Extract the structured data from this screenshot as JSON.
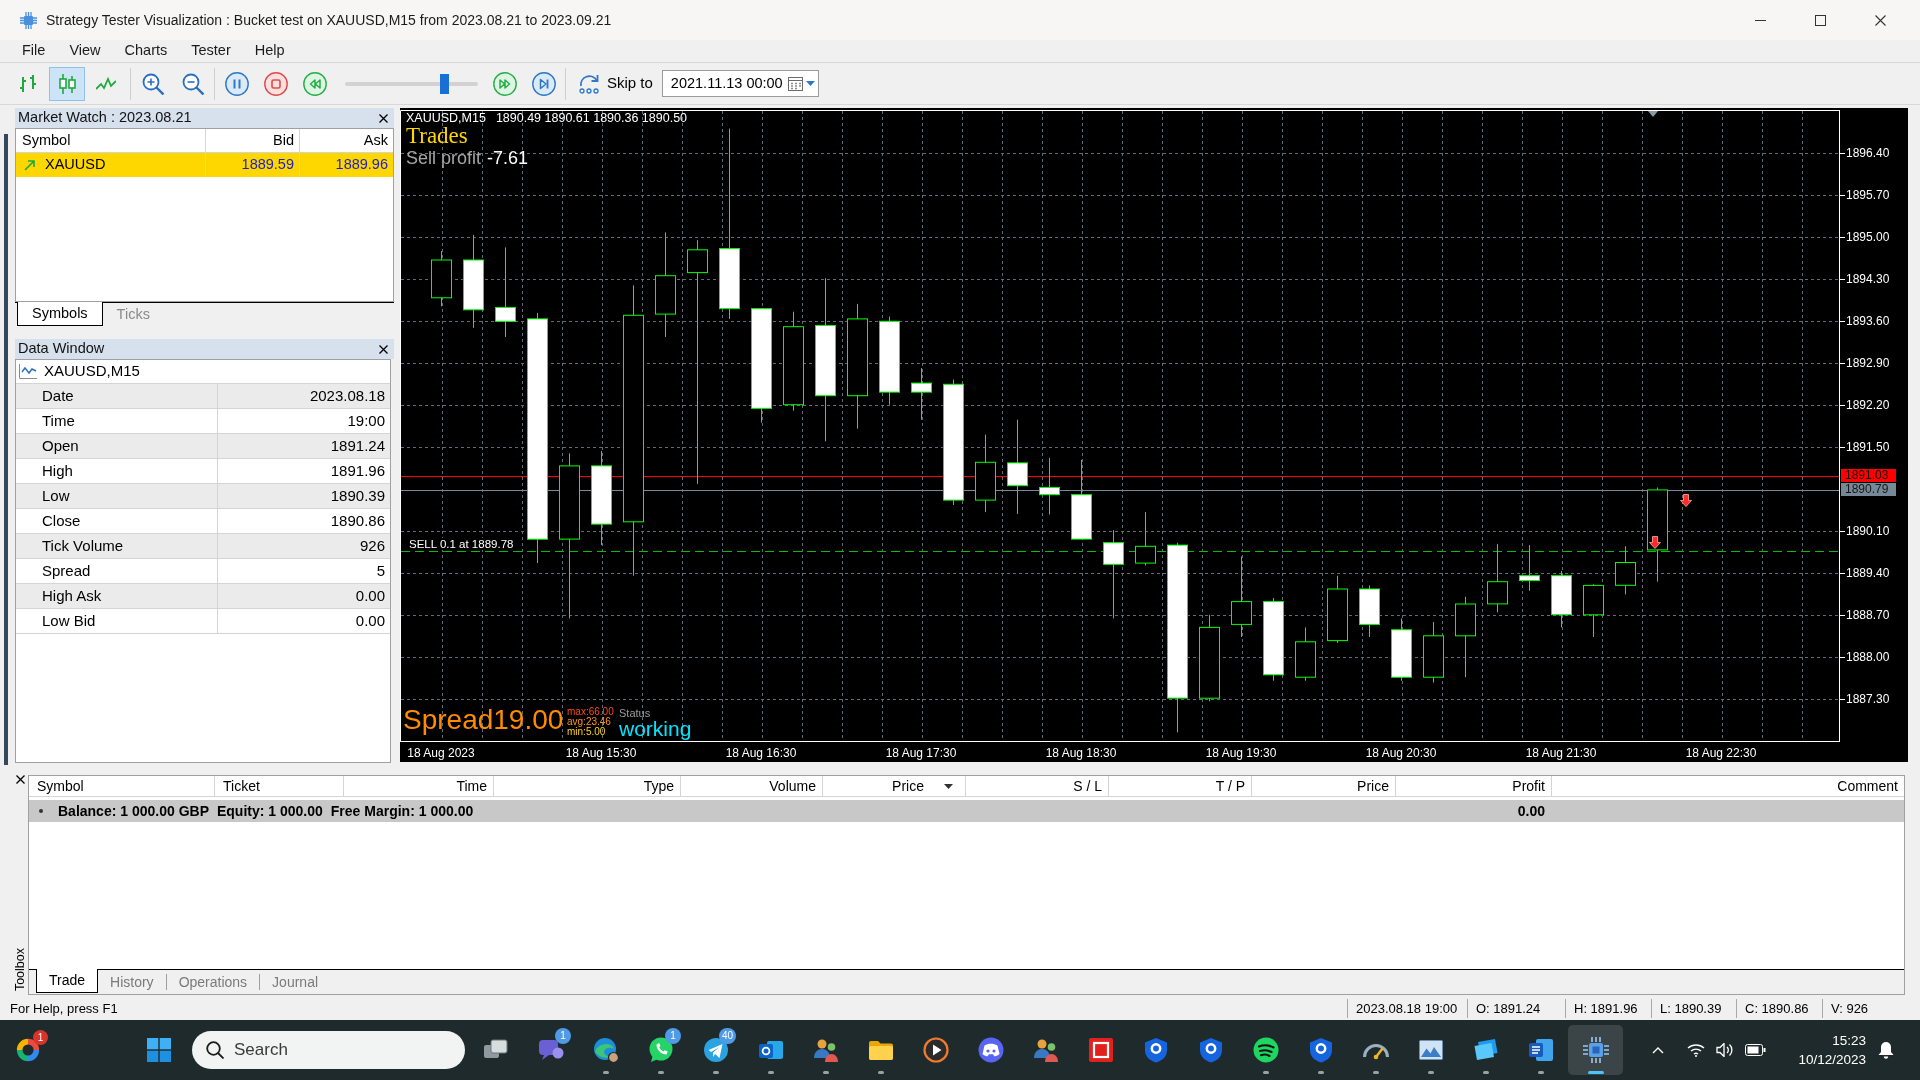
{
  "window": {
    "title": "Strategy Tester Visualization : Bucket test on XAUUSD,M15 from 2023.08.21 to 2023.09.21"
  },
  "menu": [
    "File",
    "View",
    "Charts",
    "Tester",
    "Help"
  ],
  "toolbar": {
    "chart_types": [
      {
        "kind": "bars",
        "selected": false
      },
      {
        "kind": "candles",
        "selected": true
      },
      {
        "kind": "line",
        "selected": false
      }
    ],
    "speed_slider": {
      "level": 0.75
    },
    "skip_label": "Skip to",
    "skip_date": "2021.11.13 00:00"
  },
  "market_watch": {
    "title": "Market Watch : 2023.08.21",
    "columns": [
      "Symbol",
      "Bid",
      "Ask"
    ],
    "rows": [
      {
        "symbol": "XAUUSD",
        "bid": "1889.59",
        "ask": "1889.96",
        "selected": true
      }
    ],
    "tabs": [
      {
        "label": "Symbols",
        "selected": true
      },
      {
        "label": "Ticks",
        "selected": false
      }
    ]
  },
  "data_window": {
    "title": "Data Window",
    "symbol": "XAUUSD,M15",
    "rows": [
      {
        "label": "Date",
        "value": "2023.08.18"
      },
      {
        "label": "Time",
        "value": "19:00"
      },
      {
        "label": "Open",
        "value": "1891.24"
      },
      {
        "label": "High",
        "value": "1891.96"
      },
      {
        "label": "Low",
        "value": "1890.39"
      },
      {
        "label": "Close",
        "value": "1890.86"
      },
      {
        "label": "Tick Volume",
        "value": "926"
      },
      {
        "label": "Spread",
        "value": "5"
      },
      {
        "label": "High Ask",
        "value": "0.00"
      },
      {
        "label": "Low Bid",
        "value": "0.00"
      }
    ]
  },
  "chart": {
    "symbol": "XAUUSD,M15",
    "quote": "1890.49 1890.61 1890.36 1890.50",
    "title": "Trades",
    "profit_label": "Sell profit",
    "profit_value": "-7.61",
    "spread": "Spread19.00",
    "spread_stats": [
      "max:66.00",
      "avg:23.46",
      "min:5.00"
    ],
    "status_label": "Status",
    "status_value": "working",
    "chart_data": {
      "type": "candlestick",
      "categories": [
        "18 Aug 2023",
        null,
        null,
        null,
        null,
        "18 Aug 15:30",
        null,
        null,
        null,
        null,
        "18 Aug 16:30",
        null,
        null,
        null,
        null,
        "18 Aug 17:30",
        null,
        null,
        null,
        null,
        "18 Aug 18:30",
        null,
        null,
        null,
        null,
        "18 Aug 19:30",
        null,
        null,
        null,
        null,
        "18 Aug 20:30",
        null,
        null,
        null,
        null,
        "18 Aug 21:30",
        null,
        null,
        null,
        null,
        "18 Aug 22:30",
        null,
        null,
        null
      ],
      "ohlc": [
        [
          1893.99,
          1894.77,
          1893.85,
          1894.62
        ],
        [
          1894.62,
          1895.04,
          1893.49,
          1893.79
        ],
        [
          1893.83,
          1894.83,
          1893.34,
          1893.6
        ],
        [
          1893.64,
          1893.74,
          1889.57,
          1889.97
        ],
        [
          1889.97,
          1891.4,
          1888.65,
          1891.19
        ],
        [
          1891.19,
          1891.44,
          1889.87,
          1890.22
        ],
        [
          1890.26,
          1894.2,
          1889.36,
          1893.7
        ],
        [
          1893.72,
          1895.08,
          1893.34,
          1894.36
        ],
        [
          1894.41,
          1894.95,
          1890.89,
          1894.79
        ],
        [
          1894.81,
          1896.81,
          1893.64,
          1893.81
        ],
        [
          1893.81,
          1893.81,
          1891.91,
          1892.15
        ],
        [
          1892.21,
          1893.76,
          1892.11,
          1893.51
        ],
        [
          1893.53,
          1894.32,
          1891.6,
          1892.36
        ],
        [
          1892.36,
          1893.89,
          1891.81,
          1893.64
        ],
        [
          1893.6,
          1893.68,
          1892.21,
          1892.42
        ],
        [
          1892.57,
          1892.82,
          1891.96,
          1892.42
        ],
        [
          1892.55,
          1892.63,
          1890.54,
          1890.62
        ],
        [
          1890.62,
          1891.71,
          1890.42,
          1891.25
        ],
        [
          1891.24,
          1891.96,
          1890.39,
          1890.86
        ],
        [
          1890.83,
          1891.32,
          1890.38,
          1890.71
        ],
        [
          1890.71,
          1891.29,
          1889.97,
          1889.97
        ],
        [
          1889.91,
          1890.12,
          1888.65,
          1889.55
        ],
        [
          1889.57,
          1890.42,
          1889.53,
          1889.85
        ],
        [
          1889.87,
          1889.91,
          1886.75,
          1887.32
        ],
        [
          1887.32,
          1888.71,
          1887.27,
          1888.5
        ],
        [
          1888.55,
          1889.68,
          1888.34,
          1888.93
        ],
        [
          1888.93,
          1888.99,
          1887.61,
          1887.71
        ],
        [
          1887.67,
          1888.5,
          1887.61,
          1888.26
        ],
        [
          1888.28,
          1889.36,
          1888.24,
          1889.14
        ],
        [
          1889.14,
          1889.2,
          1888.34,
          1888.55
        ],
        [
          1888.46,
          1888.65,
          1887.61,
          1887.67
        ],
        [
          1887.67,
          1888.59,
          1887.58,
          1888.36
        ],
        [
          1888.36,
          1889.01,
          1887.67,
          1888.89
        ],
        [
          1888.89,
          1889.89,
          1888.75,
          1889.26
        ],
        [
          1889.36,
          1889.87,
          1889.11,
          1889.28
        ],
        [
          1889.36,
          1889.44,
          1888.5,
          1888.71
        ],
        [
          1888.71,
          1889.22,
          1888.34,
          1889.2
        ],
        [
          1889.2,
          1889.85,
          1889.05,
          1889.58
        ],
        [
          1889.79,
          1890.83,
          1889.26,
          1890.79
        ],
        null,
        null,
        null,
        null,
        null
      ],
      "ylim": [
        1886.59,
        1897.12
      ],
      "yticks": [
        {
          "value": 1887.3,
          "label": "1887.30"
        },
        {
          "value": 1888.0,
          "label": "1888.00"
        },
        {
          "value": 1888.7,
          "label": "1888.70"
        },
        {
          "value": 1889.4,
          "label": "1889.40"
        },
        {
          "value": 1890.1,
          "label": "1890.10"
        },
        {
          "value": 1891.5,
          "label": "1891.50"
        },
        {
          "value": 1892.2,
          "label": "1892.20"
        },
        {
          "value": 1892.9,
          "label": "1892.90"
        },
        {
          "value": 1893.6,
          "label": "1893.60"
        },
        {
          "value": 1894.3,
          "label": "1894.30"
        },
        {
          "value": 1895.0,
          "label": "1895.00"
        },
        {
          "value": 1895.7,
          "label": "1895.70"
        },
        {
          "value": 1896.4,
          "label": "1896.40"
        }
      ],
      "grid": true,
      "ref_lines": [
        {
          "axis": "y",
          "value": 1891.03,
          "label": "1891.03",
          "color": "#ff0000",
          "line_style": "solid"
        },
        {
          "axis": "y",
          "value": 1890.79,
          "label": "1890.79",
          "color": "#778899",
          "line_style": "solid"
        },
        {
          "axis": "y",
          "value": 1889.78,
          "label": "SELL 0.1 at 1889.78",
          "color": "#00c000",
          "line_style": "dashed"
        }
      ]
    }
  },
  "toolbox": {
    "title": "Toolbox",
    "columns": [
      {
        "label": "Symbol",
        "sorted": false
      },
      {
        "label": "Ticket",
        "sorted": false
      },
      {
        "label": "Time",
        "sorted": false
      },
      {
        "label": "Type",
        "sorted": false
      },
      {
        "label": "Volume",
        "sorted": false
      },
      {
        "label": "Price",
        "sorted": true
      },
      {
        "label": "S / L",
        "sorted": false
      },
      {
        "label": "T / P",
        "sorted": false
      },
      {
        "label": "Price",
        "sorted": false
      },
      {
        "label": "Profit",
        "sorted": false
      },
      {
        "label": "Comment",
        "sorted": false
      }
    ],
    "summary": {
      "parts": [
        "Balance: 1 000.00 GBP",
        "Equity: 1 000.00",
        "Free Margin: 1 000.00"
      ],
      "profit": "0.00"
    },
    "tabs": [
      {
        "label": "Trade",
        "selected": true
      },
      {
        "label": "History",
        "selected": false
      },
      {
        "label": "Operations",
        "selected": false
      },
      {
        "label": "Journal",
        "selected": false
      }
    ]
  },
  "status_bar": {
    "help": "For Help, press F1",
    "fields": [
      "2023.08.18 19:00",
      "O: 1891.24",
      "H: 1891.96",
      "L: 1890.39",
      "C: 1890.86",
      "V: 926"
    ]
  },
  "taskbar": {
    "widget_badge": "1",
    "search": {
      "placeholder": "Search"
    },
    "apps": [
      {
        "kind": "stacked-windows",
        "running": false,
        "selected": false
      },
      {
        "kind": "video-chat",
        "running": false,
        "selected": false,
        "badge": "1"
      },
      {
        "kind": "browser",
        "running": true,
        "selected": false
      },
      {
        "kind": "phone-chat",
        "running": true,
        "selected": false,
        "badge": "1"
      },
      {
        "kind": "paper-plane",
        "running": true,
        "selected": false,
        "badge": "40"
      },
      {
        "kind": "mail",
        "running": true,
        "selected": false
      },
      {
        "kind": "people",
        "running": true,
        "selected": false
      },
      {
        "kind": "folder",
        "running": true,
        "selected": false
      },
      {
        "kind": "play",
        "running": false,
        "selected": false
      },
      {
        "kind": "game-controller",
        "running": false,
        "selected": false
      },
      {
        "kind": "people",
        "running": false,
        "selected": false
      },
      {
        "kind": "square-logo",
        "running": false,
        "selected": false
      },
      {
        "kind": "shield",
        "running": false,
        "selected": false
      },
      {
        "kind": "shield",
        "running": false,
        "selected": false
      },
      {
        "kind": "sound-waves",
        "running": true,
        "selected": false
      },
      {
        "kind": "shield",
        "running": true,
        "selected": false
      },
      {
        "kind": "gauge",
        "running": true,
        "selected": false
      },
      {
        "kind": "picture",
        "running": true,
        "selected": false
      },
      {
        "kind": "card",
        "running": true,
        "selected": false
      },
      {
        "kind": "document",
        "running": true,
        "selected": false
      },
      {
        "kind": "chip",
        "running": true,
        "selected": true
      }
    ],
    "clock": {
      "time": "15:23",
      "date": "10/12/2023"
    }
  }
}
